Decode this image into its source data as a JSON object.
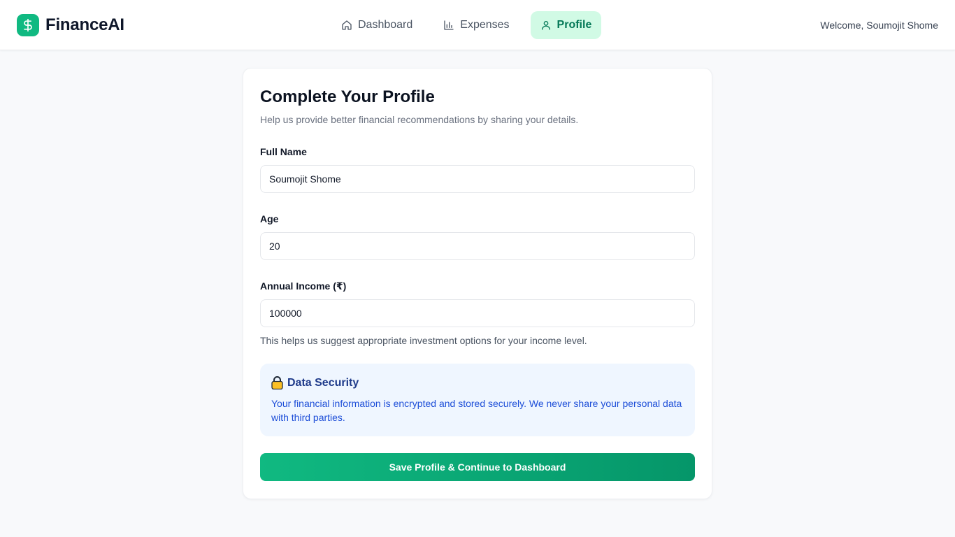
{
  "colors": {
    "brand": "#10b981",
    "brand_dark": "#059669",
    "nav_active_bg": "#d1fae5",
    "nav_active_text": "#047857",
    "security_bg": "#eff6ff",
    "security_title": "#1e3a8a",
    "security_text": "#1d4ed8"
  },
  "header": {
    "logo_icon": "dollar-icon",
    "app_name": "FinanceAI",
    "welcome": "Welcome, Soumojit Shome",
    "nav": [
      {
        "label": "Dashboard",
        "icon": "home-icon",
        "active": false
      },
      {
        "label": "Expenses",
        "icon": "bar-chart-icon",
        "active": false
      },
      {
        "label": "Profile",
        "icon": "user-icon",
        "active": true
      }
    ]
  },
  "form": {
    "title": "Complete Your Profile",
    "subtitle": "Help us provide better financial recommendations by sharing your details.",
    "full_name": {
      "label": "Full Name",
      "value": "Soumojit Shome"
    },
    "age": {
      "label": "Age",
      "value": "20"
    },
    "income": {
      "label": "Annual Income (₹)",
      "value": "100000",
      "helper": "This helps us suggest appropriate investment options for your income level."
    },
    "security": {
      "icon": "lock-icon",
      "title": "Data Security",
      "text": "Your financial information is encrypted and stored securely. We never share your personal data with third parties."
    },
    "submit_label": "Save Profile & Continue to Dashboard"
  }
}
